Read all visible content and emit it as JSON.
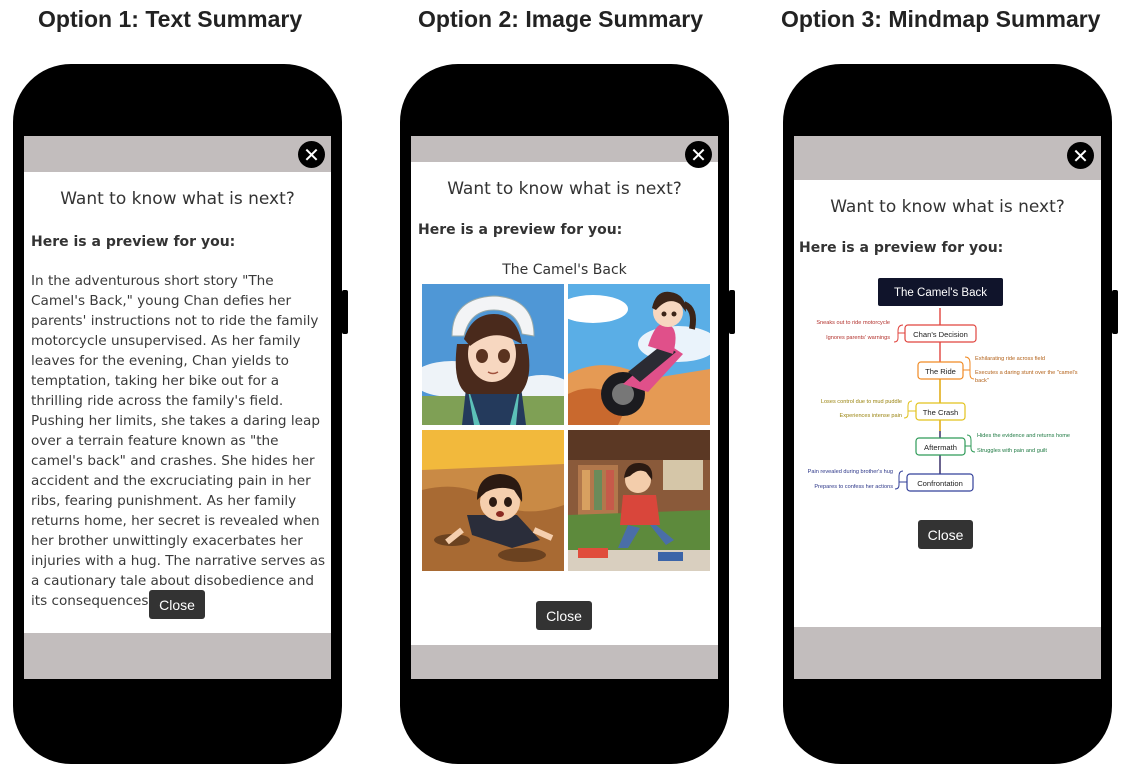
{
  "titles": [
    "Option 1: Text Summary",
    "Option 2: Image Summary",
    "Option 3: Mindmap Summary"
  ],
  "dialog": {
    "close_glyph": "✕",
    "heading": "Want to know what is next?",
    "preview_label": "Here is a preview for you:",
    "close_label": "Close"
  },
  "text_summary": "In the adventurous short story \"The Camel's Back,\" young Chan defies her parents' instructions not to ride the family motorcycle unsupervised. As her family leaves for the evening, Chan yields to temptation, taking her bike out for a thrilling ride across the family's field. Pushing her limits, she takes a daring leap over a terrain feature known as \"the camel's back\" and crashes. She hides her accident and the excruciating pain in her ribs, fearing punishment. As her family returns home, her secret is revealed when her brother unwittingly exacerbates her injuries with a hug. The narrative serves as a cautionary tale about disobedience and its consequences.",
  "image_summary": {
    "title": "The Camel's Back",
    "images": [
      "anime-girl-helmet-portrait",
      "anime-girl-riding-motorcycle",
      "anime-girl-crashed-in-dirt",
      "anime-girl-hurt-on-couch"
    ]
  },
  "mindmap": {
    "root": "The Camel's Back",
    "nodes": [
      {
        "label": "Chan's Decision",
        "color": "#e0453f",
        "left": [
          "Sneaks out to ride motorcycle",
          "Ignores parents' warnings"
        ]
      },
      {
        "label": "The Ride",
        "color": "#f08a24",
        "right": [
          "Exhilarating ride across field",
          "Executes a daring stunt over the \"camel's",
          "back\""
        ]
      },
      {
        "label": "The Crash",
        "color": "#e2c21c",
        "left": [
          "Loses control due to mud puddle",
          "Experiences intense pain"
        ]
      },
      {
        "label": "Aftermath",
        "color": "#2d9a57",
        "right": [
          "Hides the evidence and returns home",
          "Struggles with pain and guilt"
        ]
      },
      {
        "label": "Confrontation",
        "color": "#33409a",
        "left": [
          "Pain revealed during brother's hug",
          "Prepares to confess her actions"
        ]
      }
    ]
  },
  "colors": {
    "gray_bar": "#c2bdbd",
    "close_button": "#333333",
    "root_node": "#10142b"
  }
}
